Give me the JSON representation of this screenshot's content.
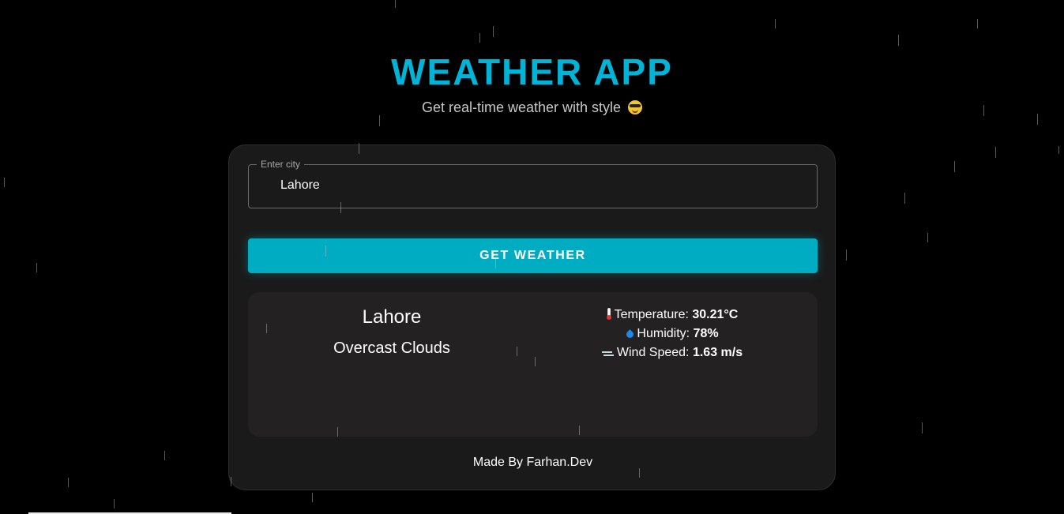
{
  "header": {
    "title": "WEATHER APP",
    "subtitle": "Get real-time weather with style",
    "subtitle_emoji": "smiling-face-with-sunglasses-icon"
  },
  "search": {
    "legend": "Enter city",
    "value": "Lahore",
    "button_label": "GET WEATHER"
  },
  "result": {
    "city": "Lahore",
    "condition": "Overcast Clouds",
    "temperature_label": "Temperature:",
    "temperature_value": "30.21°C",
    "humidity_label": "Humidity:",
    "humidity_value": "78%",
    "wind_label": "Wind Speed:",
    "wind_value": "1.63 m/s",
    "icons": [
      "thermometer-icon",
      "droplet-icon",
      "wind-icon"
    ]
  },
  "footer": {
    "text": "Made By Farhan.Dev"
  },
  "colors": {
    "background": "#000000",
    "accent": "#00b4d8",
    "button": "#00acc1",
    "card": "#1a1a1a",
    "result_panel": "#232122"
  }
}
